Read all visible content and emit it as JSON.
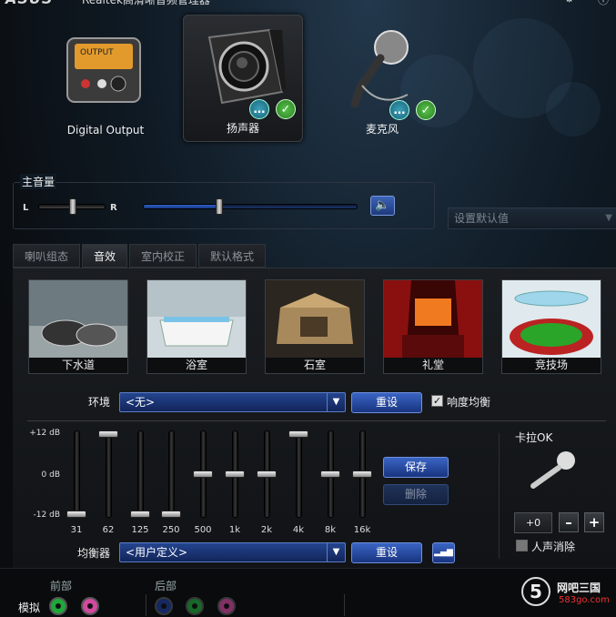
{
  "window": {
    "brand": "ASUS",
    "title": "Realtek高清晰音频管理器"
  },
  "devices": [
    {
      "label": "Digital Output",
      "icon": "digital-output-icon",
      "selected": false
    },
    {
      "label": "扬声器",
      "icon": "speaker-icon",
      "selected": true
    },
    {
      "label": "麦克风",
      "icon": "microphone-icon",
      "selected": false
    }
  ],
  "volume": {
    "title": "主音量",
    "left": "L",
    "right": "R",
    "balance": 0.5,
    "level": 0.35
  },
  "default_device": {
    "placeholder": "设置默认值"
  },
  "tabs": [
    {
      "label": "喇叭组态",
      "active": false
    },
    {
      "label": "音效",
      "active": true
    },
    {
      "label": "室内校正",
      "active": false
    },
    {
      "label": "默认格式",
      "active": false
    }
  ],
  "environments": [
    "下水道",
    "浴室",
    "石室",
    "礼堂",
    "竞技场"
  ],
  "environment": {
    "label": "环境",
    "value": "<无>",
    "reset": "重设",
    "loudness_label": "响度均衡",
    "loudness_checked": true
  },
  "eq": {
    "db_labels": [
      "+12 dB",
      "0 dB",
      "-12 dB"
    ],
    "bands": [
      "31",
      "62",
      "125",
      "250",
      "500",
      "1k",
      "2k",
      "4k",
      "8k",
      "16k"
    ],
    "band_gains_db": [
      -12,
      12,
      -12,
      -12,
      0,
      0,
      0,
      12,
      0,
      0
    ],
    "save": "保存",
    "delete": "删除",
    "label": "均衡器",
    "preset": "<用户定义>",
    "reset": "重设"
  },
  "karaoke": {
    "title": "卡拉OK",
    "value": "+0",
    "minus": "–",
    "plus": "+",
    "vocal_cancel_label": "人声消除",
    "vocal_cancel_checked": false
  },
  "bottom": {
    "front": "前部",
    "rear": "后部",
    "analog": "模拟"
  },
  "watermark": {
    "name": "网吧三国",
    "site": "583go.com"
  },
  "colors": {
    "accent": "#1e3a7c",
    "jack_green": "#1fa83a",
    "jack_pink": "#d14aa0",
    "jack_blue": "#1e3c9a"
  }
}
